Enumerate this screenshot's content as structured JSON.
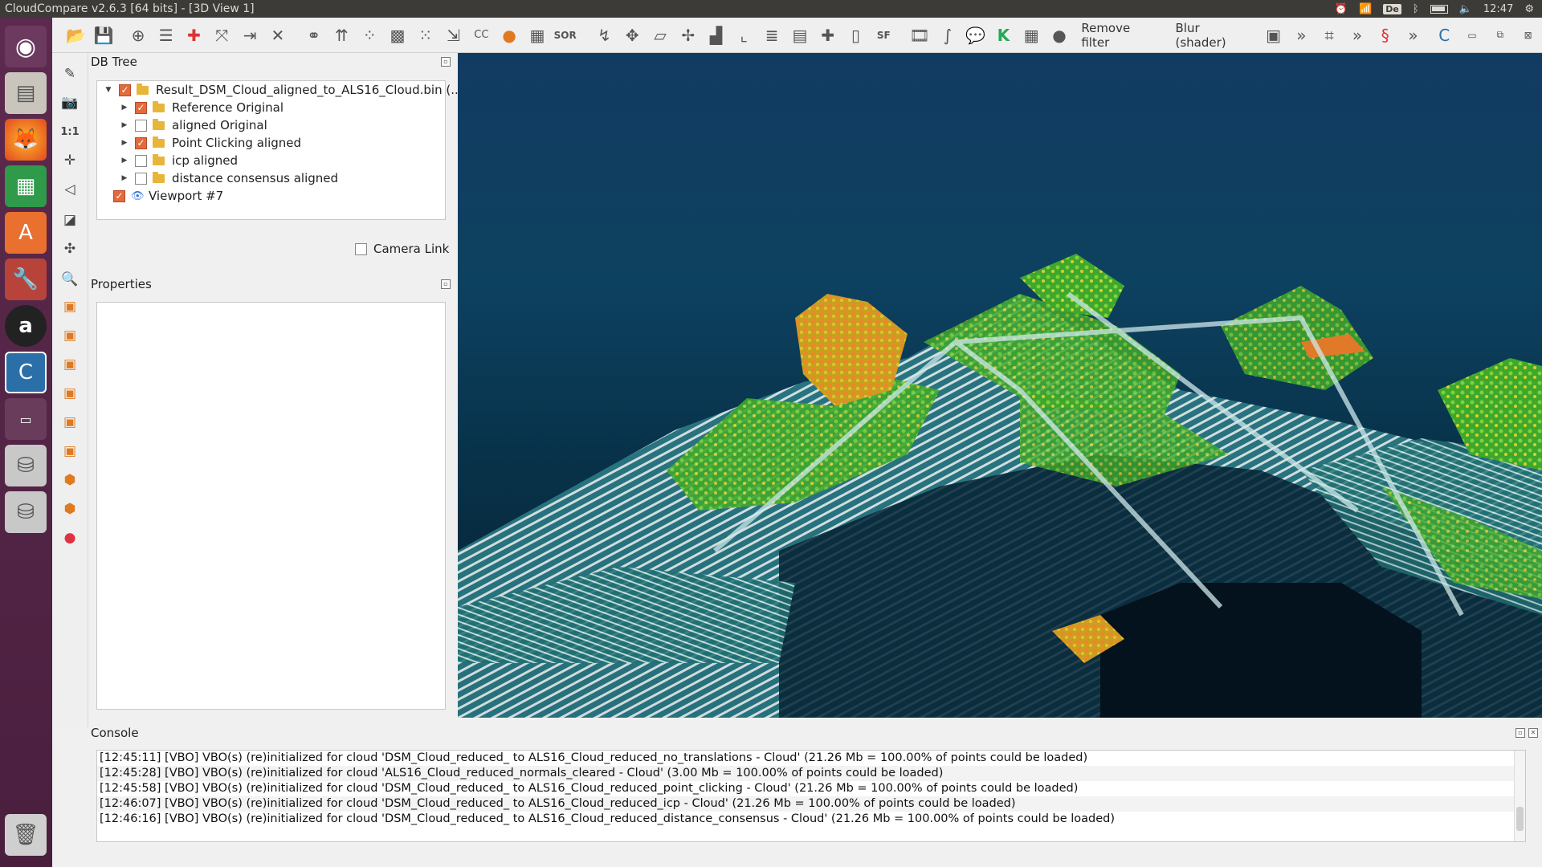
{
  "window": {
    "title": "CloudCompare v2.6.3 [64 bits] - [3D View 1]"
  },
  "tray": {
    "keyboard": "De",
    "time": "12:47"
  },
  "toolbar": {
    "remove_filter_label": "Remove filter",
    "blur_label": "Blur (shader)",
    "more_label": "»"
  },
  "vertical_toolbar": {
    "one_to_one_label": "1:1"
  },
  "db_tree": {
    "title": "DB Tree",
    "root_label": "Result_DSM_Cloud_aligned_to_ALS16_Cloud.bin (...",
    "items": [
      {
        "label": "Reference Original",
        "checked": true
      },
      {
        "label": "aligned Original",
        "checked": false
      },
      {
        "label": "Point Clicking aligned",
        "checked": true
      },
      {
        "label": "icp aligned",
        "checked": false
      },
      {
        "label": "distance consensus aligned",
        "checked": false
      }
    ],
    "viewport_label": "Viewport #7"
  },
  "camera_link": {
    "label": "Camera Link",
    "checked": false
  },
  "properties": {
    "title": "Properties"
  },
  "console": {
    "title": "Console",
    "lines": [
      "[12:45:11] [VBO] VBO(s) (re)initialized for cloud 'DSM_Cloud_reduced_ to ALS16_Cloud_reduced_no_translations - Cloud' (21.26 Mb = 100.00% of points could be loaded)",
      "[12:45:28] [VBO] VBO(s) (re)initialized for cloud 'ALS16_Cloud_reduced_normals_cleared - Cloud' (3.00 Mb = 100.00% of points could be loaded)",
      "[12:45:58] [VBO] VBO(s) (re)initialized for cloud 'DSM_Cloud_reduced_ to ALS16_Cloud_reduced_point_clicking - Cloud' (21.26 Mb = 100.00% of points could be loaded)",
      "[12:46:07] [VBO] VBO(s) (re)initialized for cloud 'DSM_Cloud_reduced_ to ALS16_Cloud_reduced_icp - Cloud' (21.26 Mb = 100.00% of points could be loaded)",
      "[12:46:16] [VBO] VBO(s) (re)initialized for cloud 'DSM_Cloud_reduced_ to ALS16_Cloud_reduced_distance_consensus - Cloud' (21.26 Mb = 100.00% of points could be loaded)"
    ]
  },
  "colors": {
    "accent_check": "#e46a3a",
    "launcher": "#5c2a4e",
    "view_background": "#0d4160",
    "point_green": "#4fc232",
    "point_white": "#e8f0f0",
    "point_teal": "#2d8c86",
    "point_orange": "#e8a030"
  }
}
